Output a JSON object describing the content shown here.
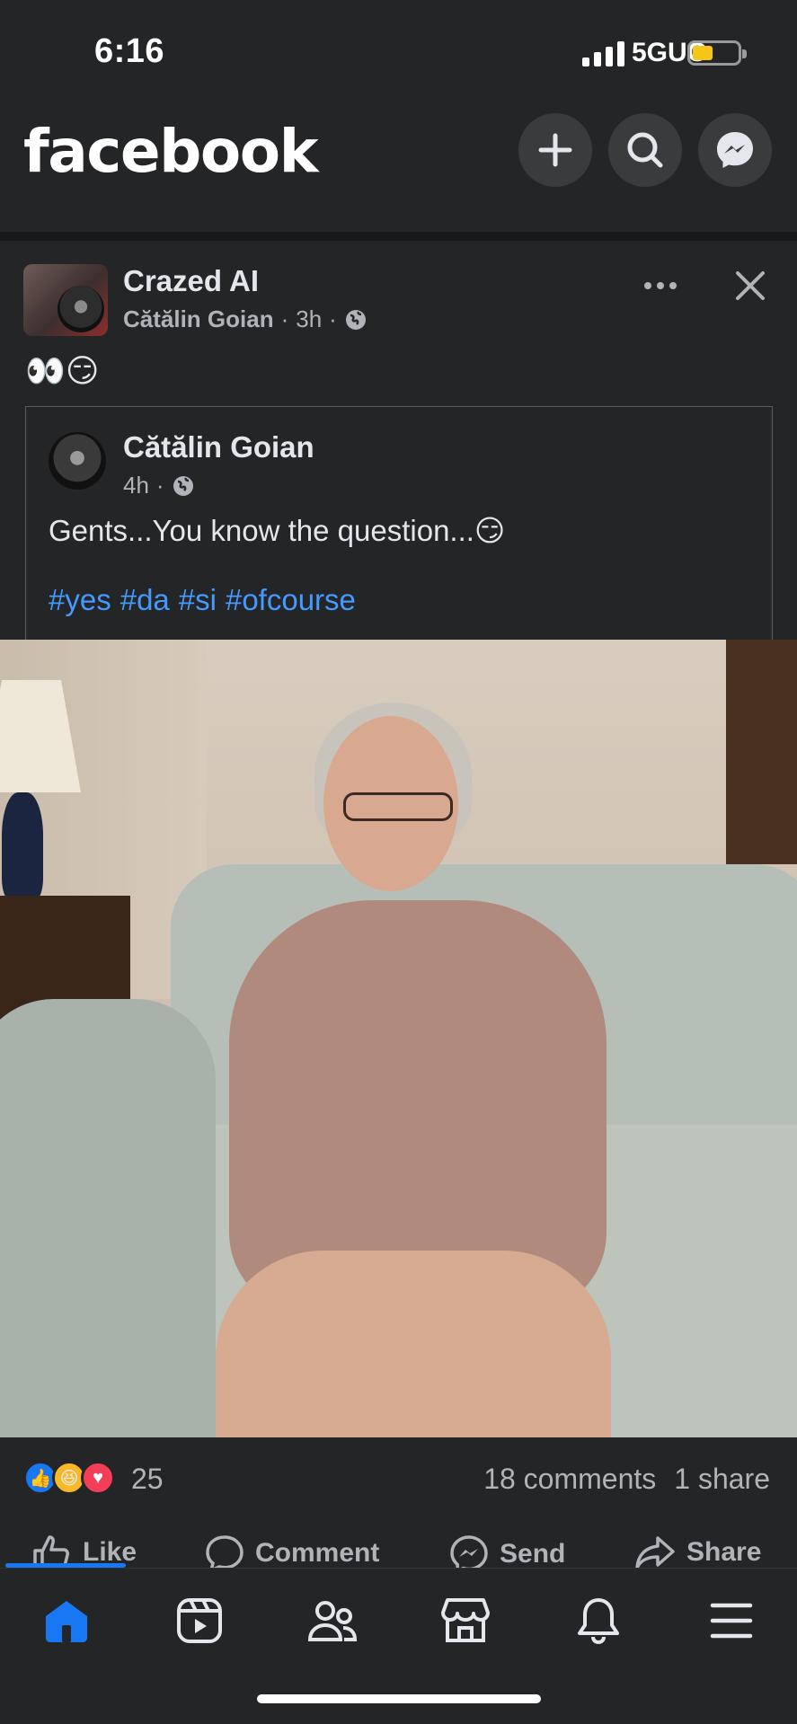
{
  "status_bar": {
    "time": "6:16",
    "network": "5GUC",
    "battery_color": "#f5c518"
  },
  "header": {
    "logo": "facebook",
    "icons": [
      "plus-icon",
      "search-icon",
      "messenger-icon"
    ]
  },
  "post": {
    "page_name": "Crazed AI",
    "author": "Cătălin Goian",
    "time": "3h",
    "privacy_icon": "globe-icon",
    "text": "👀😏",
    "shared": {
      "author": "Cătălin Goian",
      "time": "4h",
      "body": "Gents...You know the question...😏",
      "hashtags": [
        "#yes",
        "#da",
        "#si",
        "#ofcourse"
      ]
    },
    "reactions": {
      "types": [
        "like",
        "haha",
        "love"
      ],
      "count": "25",
      "comments": "18 comments",
      "shares": "1 share"
    },
    "actions": {
      "like": "Like",
      "comment": "Comment",
      "send": "Send",
      "share": "Share"
    }
  },
  "bottom_nav": {
    "items": [
      "home-icon",
      "video-icon",
      "friends-icon",
      "marketplace-icon",
      "notifications-icon",
      "menu-icon"
    ],
    "active": "home-icon",
    "accent": "#1877f2"
  }
}
